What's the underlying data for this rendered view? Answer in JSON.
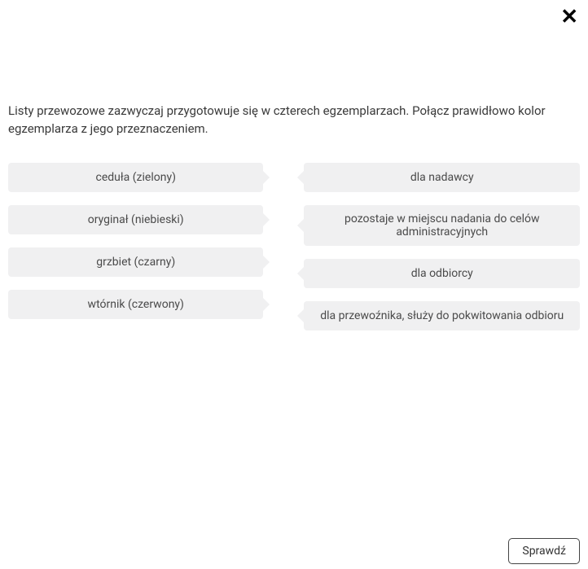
{
  "close_label": "✕",
  "question": "Listy przewozowe zazwyczaj przygotowuje się w czterech egzemplarzach. Połącz prawidłowo kolor egzemplarza z jego przeznaczeniem.",
  "left": [
    "ceduła (zielony)",
    "oryginał (niebieski)",
    "grzbiet (czarny)",
    "wtórnik (czerwony)"
  ],
  "right": [
    "dla nadawcy",
    "pozostaje w miejscu nadania do celów administracyjnych",
    "dla odbiorcy",
    "dla przewoźnika, służy do pokwitowania odbioru"
  ],
  "check_button": "Sprawdź"
}
